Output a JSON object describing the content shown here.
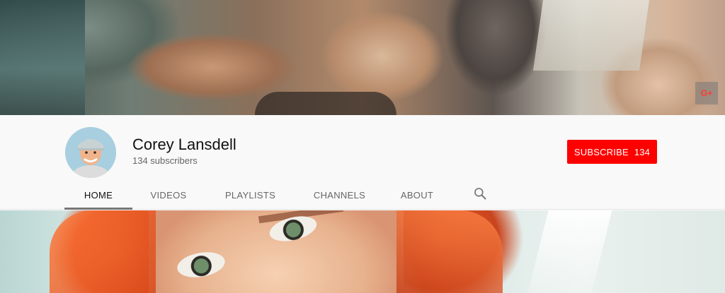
{
  "channel": {
    "name": "Corey Lansdell",
    "subscribers_text": "134 subscribers"
  },
  "subscribe": {
    "label": "SUBSCRIBE",
    "count": "134",
    "color": "#ff0000"
  },
  "tabs": [
    {
      "label": "HOME",
      "active": true
    },
    {
      "label": "VIDEOS",
      "active": false
    },
    {
      "label": "PLAYLISTS",
      "active": false
    },
    {
      "label": "CHANNELS",
      "active": false
    },
    {
      "label": "ABOUT",
      "active": false
    }
  ],
  "icons": {
    "social": "google-plus-icon",
    "search": "search-icon"
  },
  "social_link_label": "G+"
}
